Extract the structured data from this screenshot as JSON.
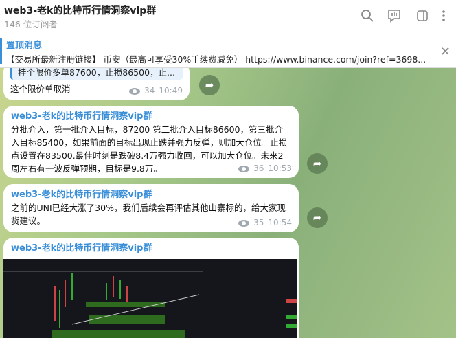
{
  "header": {
    "title": "web3-老k的比特币行情洞察vip群",
    "subscribers": "146 位订阅者"
  },
  "pinned": {
    "title": "置顶消息",
    "text": "【交易所最新注册链接】 币安（最高可享受30%手续费减免） https://www.binance.com/join?ref=3698..."
  },
  "messages": [
    {
      "quote": "挂个限价多单87600，止损86500，止...",
      "text": "这个限价单取消",
      "views": "34",
      "time": "10:49"
    },
    {
      "sender": "web3-老k的比特币行情洞察vip群",
      "text": "分批介入，第一批介入目标，87200 第二批介入目标86600，第三批介入目标85400，如果前面的目标出现止跌并强力反弹，则加大仓位。止损点设置在83500.最佳时刻是跌破8.4万强力收回，可以加大仓位。未来2周左右有一波反弹预期，目标是9.8万。",
      "views": "36",
      "time": "10:53"
    },
    {
      "sender": "web3-老k的比特币行情洞察vip群",
      "text": "之前的UNI已经大涨了30%，我们后续会再评估其他山寨标的，给大家现货建议。",
      "views": "35",
      "time": "10:54"
    },
    {
      "sender": "web3-老k的比特币行情洞察vip群"
    }
  ]
}
